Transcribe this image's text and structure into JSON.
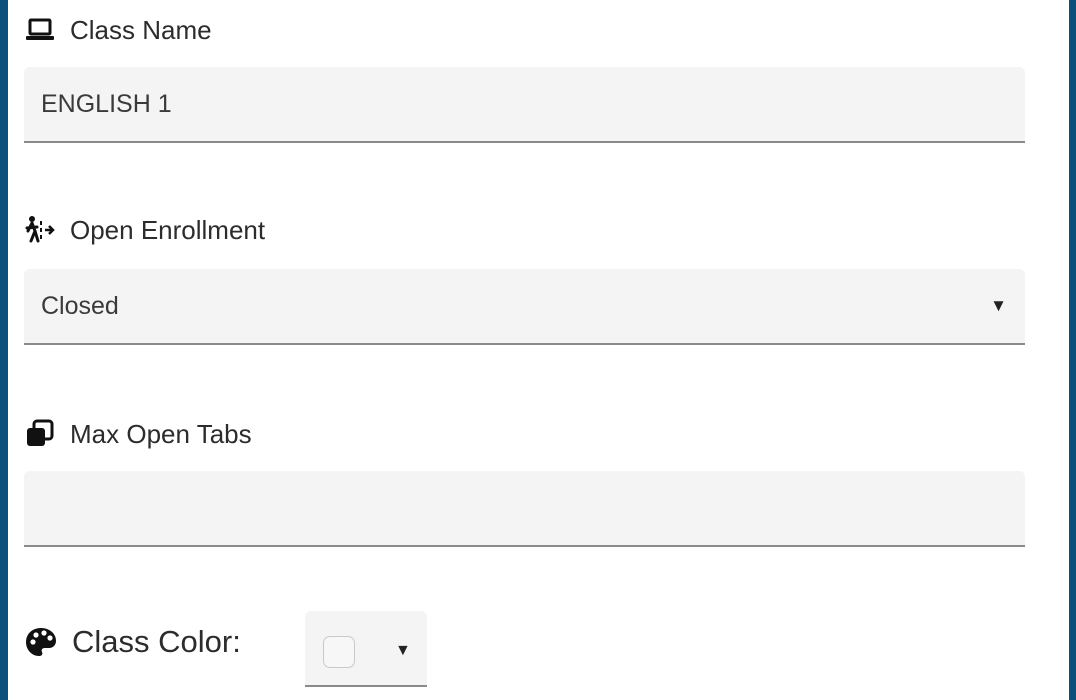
{
  "class_name": {
    "label": "Class Name",
    "icon": "laptop-icon",
    "value": "ENGLISH 1"
  },
  "open_enrollment": {
    "label": "Open Enrollment",
    "icon": "walk-in-icon",
    "selected": "Closed",
    "caret": "▼"
  },
  "max_open_tabs": {
    "label": "Max Open Tabs",
    "icon": "tabs-icon",
    "value": ""
  },
  "class_color": {
    "label": "Class Color:",
    "icon": "palette-icon",
    "swatch_color": "#f7f7f7",
    "caret": "▼"
  },
  "colors": {
    "frame": "#0b4f7b",
    "field_bg": "#f4f4f4",
    "field_border": "#8a8a8a"
  }
}
